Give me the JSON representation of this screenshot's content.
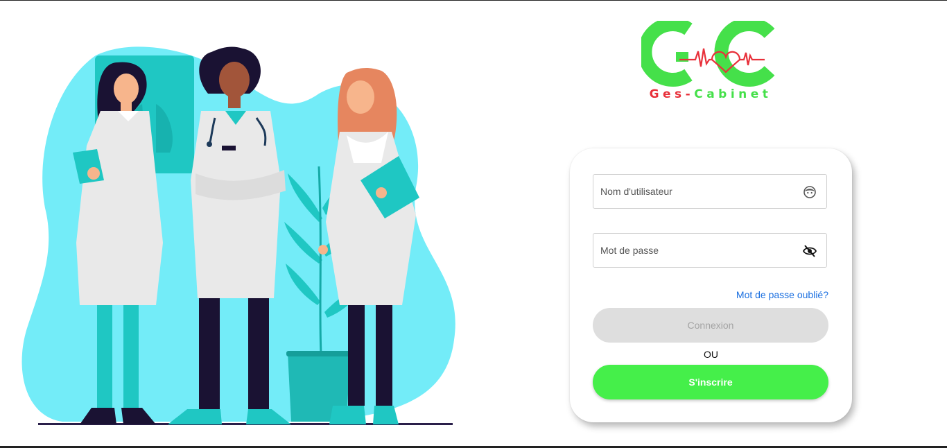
{
  "brand": {
    "name_part1": "Ges-",
    "name_part2": "Cabinet",
    "colors": {
      "red": "#e8303a",
      "green": "#45e04a"
    }
  },
  "login": {
    "username_placeholder": "Nom d'utilisateur",
    "username_icon": "face-icon",
    "password_placeholder": "Mot de passe",
    "password_icon": "eye-off-icon",
    "forgot_label": "Mot de passe oublié?",
    "login_label": "Connexion",
    "or_label": "OU",
    "signup_label": "S'inscrire"
  },
  "colors": {
    "accent_green": "#45ef4a",
    "link_blue": "#1a6fe0",
    "blob_cyan": "#73ecf8",
    "disabled_gray": "#dedede"
  }
}
